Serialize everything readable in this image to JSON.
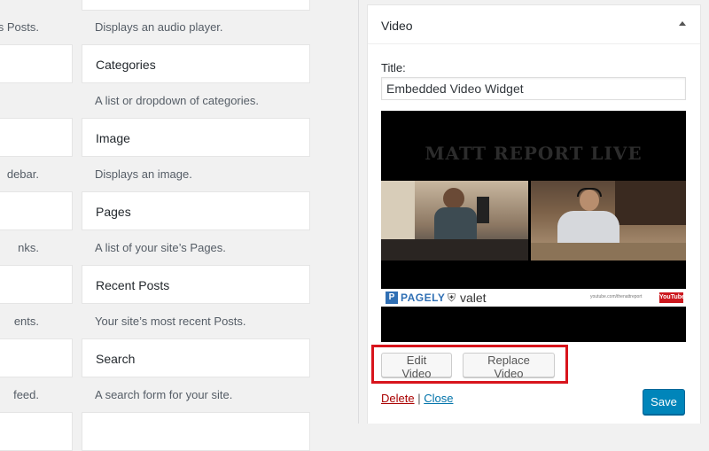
{
  "left_column": {
    "descriptions": [
      "s Posts.",
      "debar.",
      "nks.",
      "ents.",
      "feed."
    ]
  },
  "widgets": [
    {
      "title": "",
      "description": "Displays an audio player."
    },
    {
      "title": "Categories",
      "description": "A list or dropdown of categories."
    },
    {
      "title": "Image",
      "description": "Displays an image."
    },
    {
      "title": "Pages",
      "description": "A list of your site’s Pages."
    },
    {
      "title": "Recent Posts",
      "description": "Your site’s most recent Posts."
    },
    {
      "title": "Search",
      "description": "A search form for your site."
    },
    {
      "title": "",
      "description": ""
    }
  ],
  "video_panel": {
    "title": "Video",
    "title_label": "Title:",
    "title_value": "Embedded Video Widget",
    "video": {
      "banner_text": "MATT REPORT LIVE",
      "sponsor_1": "PAGELY",
      "sponsor_1_badge": "P",
      "sponsor_2": "valet",
      "url_text": "youtube.com/thenattreport",
      "youtube_badge": "YouTube"
    },
    "edit_button": "Edit Video",
    "replace_button": "Replace Video",
    "delete_link": "Delete",
    "separator": "|",
    "close_link": "Close",
    "save_button": "Save"
  },
  "colors": {
    "background": "#f1f1f1",
    "primary_button": "#0085ba",
    "highlight_border": "#d8141c",
    "delete_link": "#a00",
    "close_link": "#0073aa"
  }
}
